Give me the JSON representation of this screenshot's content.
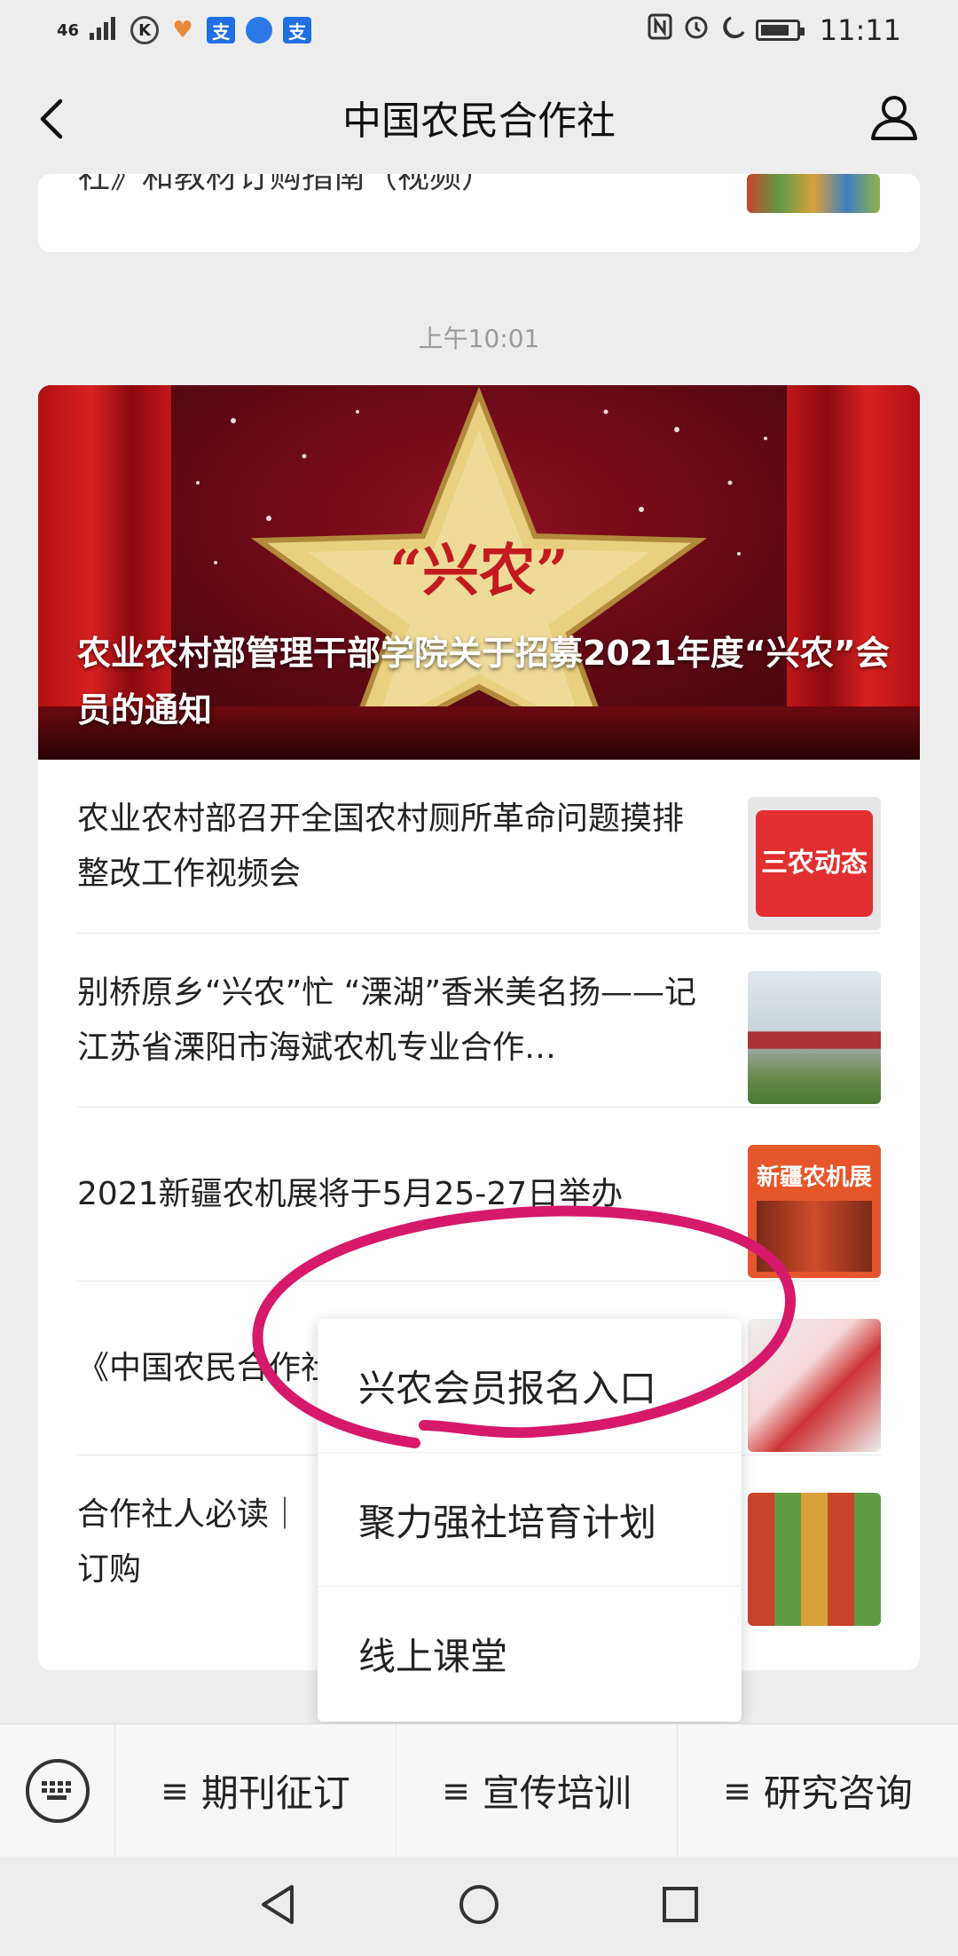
{
  "status_bar": {
    "signal": "46",
    "time": "11:11",
    "icons": [
      "k-icon",
      "heart-icon",
      "alipay-icon",
      "browser-icon",
      "alipay-icon",
      "nfc-icon",
      "alarm-icon",
      "moon-icon",
      "battery-icon"
    ]
  },
  "header": {
    "title": "中国农民合作社",
    "back_icon": "chevron-left-icon",
    "profile_icon": "user-icon"
  },
  "feed": {
    "top_card_text": "社》和教材订购指南（视频）",
    "timestamp": "上午10:01",
    "hero_title": "农业农村部管理干部学院关于招募2021年度“兴农”会员的通知",
    "hero_star_text": "“兴农”",
    "items": [
      {
        "text": "农业农村部召开全国农村厕所革命问题摸排整改工作视频会",
        "thumb": "三农动态"
      },
      {
        "text": "别桥原乡“兴农”忙 “溧湖”香米美名扬——记江苏省溧阳市海斌农机专业合作…",
        "thumb": ""
      },
      {
        "text": "2021新疆农机展将于5月25-27日举办",
        "thumb": "新疆农机展"
      },
      {
        "text": "《中国农民合作社》",
        "thumb": ""
      },
      {
        "text": "合作社人必读｜《中国农民合作社》和教材订购",
        "thumb": ""
      }
    ]
  },
  "popup_menu": {
    "items": [
      "兴农会员报名入口",
      "聚力强社培育计划",
      "线上课堂"
    ]
  },
  "bottom_menu": {
    "keyboard_icon": "keyboard-icon",
    "items": [
      "期刊征订",
      "宣传培训",
      "研究咨询"
    ]
  },
  "colors": {
    "background": "#ededed",
    "annotation_circle": "#d6196b",
    "hero_red": "#8e1020"
  }
}
